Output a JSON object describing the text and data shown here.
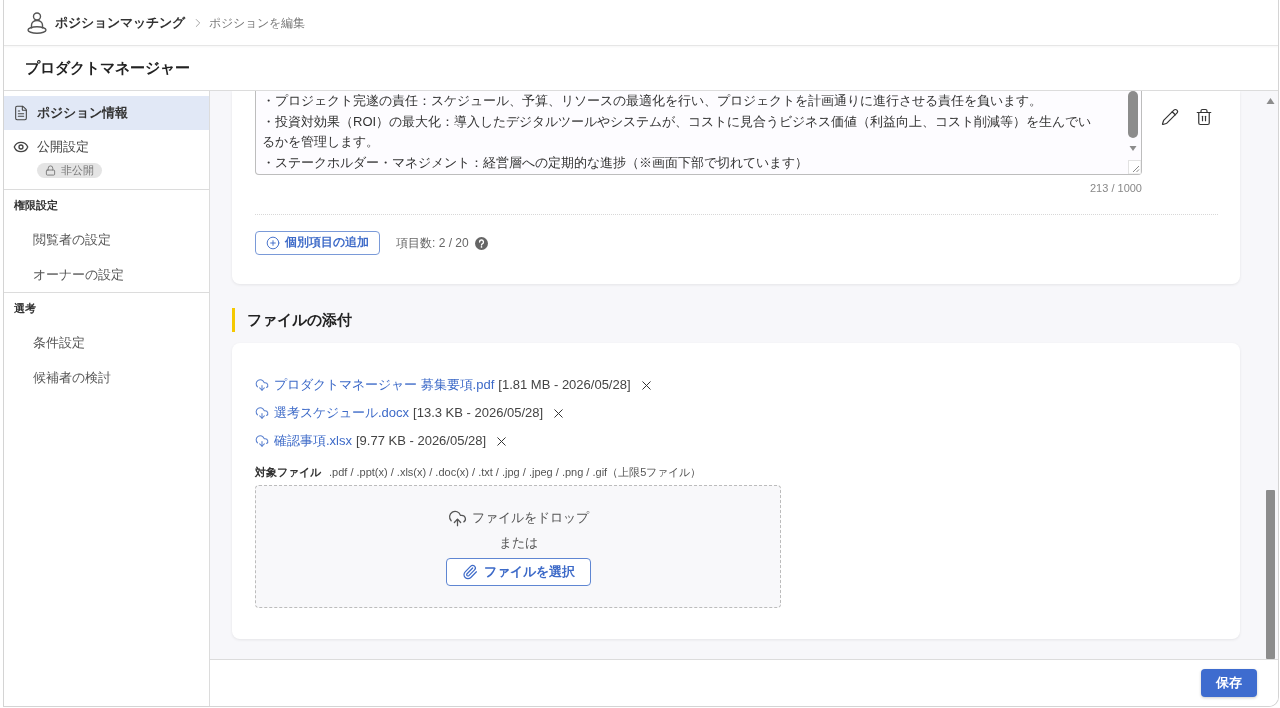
{
  "header": {
    "app_title": "ポジションマッチング",
    "breadcrumb_current": "ポジションを編集"
  },
  "page_title": "プロダクトマネージャー",
  "sidebar": {
    "items": [
      {
        "label": "ポジション情報",
        "selected": true
      },
      {
        "label": "公開設定",
        "selected": false,
        "badge": "非公開"
      }
    ],
    "sections": [
      {
        "title": "権限設定",
        "items": [
          {
            "label": "閲覧者の設定",
            "selected": false
          },
          {
            "label": "オーナーの設定",
            "selected": false
          }
        ]
      },
      {
        "title": "選考",
        "items": [
          {
            "label": "条件設定",
            "selected": false
          },
          {
            "label": "候補者の検討",
            "selected": false
          }
        ]
      }
    ]
  },
  "custom_item": {
    "description_lines": [
      "・プロジェクト完遂の責任：スケジュール、予算、リソースの最適化を行い、プロジェクトを計画通りに進行させる責任を負います。",
      "・投資対効果（ROI）の最大化：導入したデジタルツールやシステムが、コストに見合うビジネス価値（利益向上、コスト削減等）を生んでいるかを管理します。",
      "・ステークホルダー・マネジメント：経営層への定期的な進捗（※画面下部で切れています）"
    ],
    "counter": "213 / 1000"
  },
  "add_item_button": "個別項目の追加",
  "item_count": "項目数: 2 / 20",
  "attachments": {
    "heading": "ファイルの添付",
    "files": [
      {
        "name": "プロダクトマネージャー 募集要項.pdf",
        "meta": "[1.81 MB - 2026/05/28]"
      },
      {
        "name": "選考スケジュール.docx",
        "meta": "[13.3 KB - 2026/05/28]"
      },
      {
        "name": "確認事項.xlsx",
        "meta": "[9.77 KB - 2026/05/28]"
      }
    ],
    "accepted_label": "対象ファイル",
    "accepted_types": ".pdf / .ppt(x) / .xls(x) / .doc(x) / .txt / .jpg / .jpeg / .png / .gif（上限5ファイル）",
    "dropzone": {
      "prompt": "ファイルをドロップ",
      "or": "または",
      "button": "ファイルを選択"
    }
  },
  "footer": {
    "save_button": "保存"
  }
}
